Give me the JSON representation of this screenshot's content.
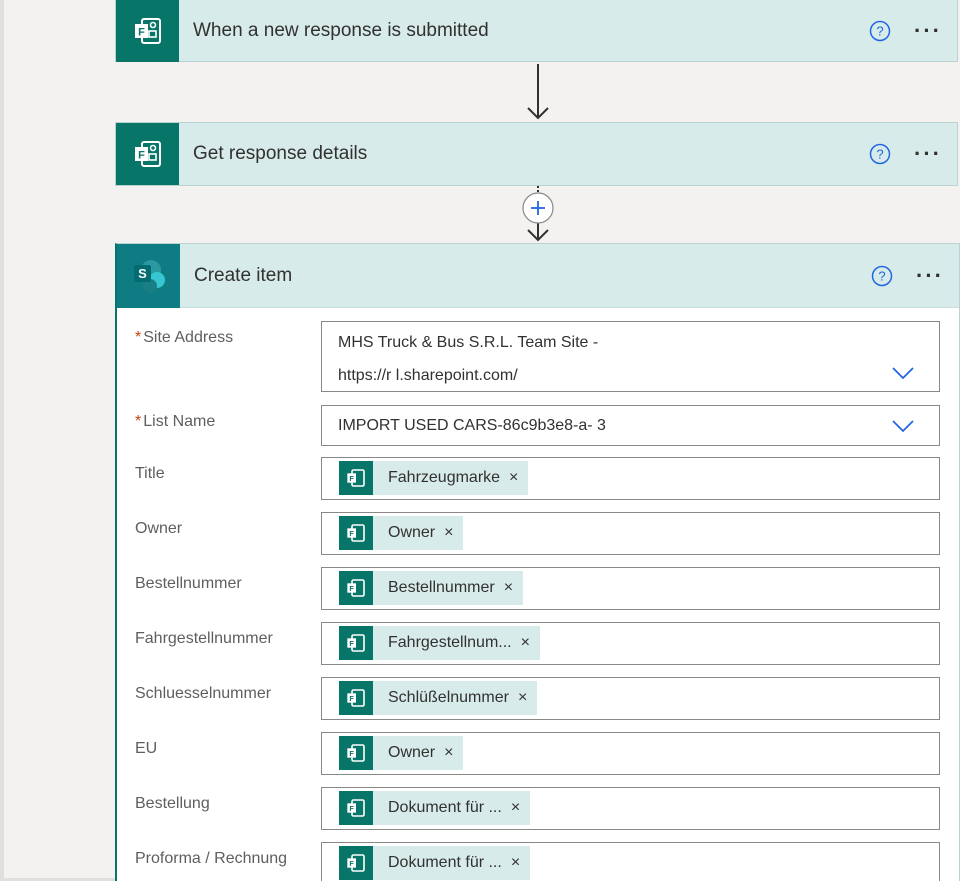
{
  "trigger": {
    "title": "When a new response is submitted"
  },
  "get_details": {
    "title": "Get response details"
  },
  "create_item": {
    "title": "Create item",
    "fields": [
      {
        "label": "Site Address",
        "required": true,
        "line1": "MHS Truck &  Bus S.R.L. Team Site -",
        "line2": "https://r                    l.sharepoint.com/"
      },
      {
        "label": "List Name",
        "required": true,
        "value": "IMPORT USED CARS-86c9b3e8-a-                           3"
      },
      {
        "label": "Title",
        "token": "Fahrzeugmarke"
      },
      {
        "label": "Owner",
        "token": "Owner"
      },
      {
        "label": "Bestellnummer",
        "token": "Bestellnummer"
      },
      {
        "label": "Fahrgestellnummer",
        "token": "Fahrgestellnum..."
      },
      {
        "label": "Schluesselnummer",
        "token": "Schlüßelnummer"
      },
      {
        "label": "EU",
        "token": "Owner"
      },
      {
        "label": "Bestellung",
        "token": "Dokument für ..."
      },
      {
        "label": "Proforma / Rechnung",
        "token": "Dokument für ..."
      }
    ]
  },
  "glyphs": {
    "more": "···",
    "close": "×",
    "required_mark": "*"
  },
  "colors": {
    "forms_green": "#077568",
    "header_bg": "#d7ebea",
    "help_blue": "#2266e3"
  }
}
